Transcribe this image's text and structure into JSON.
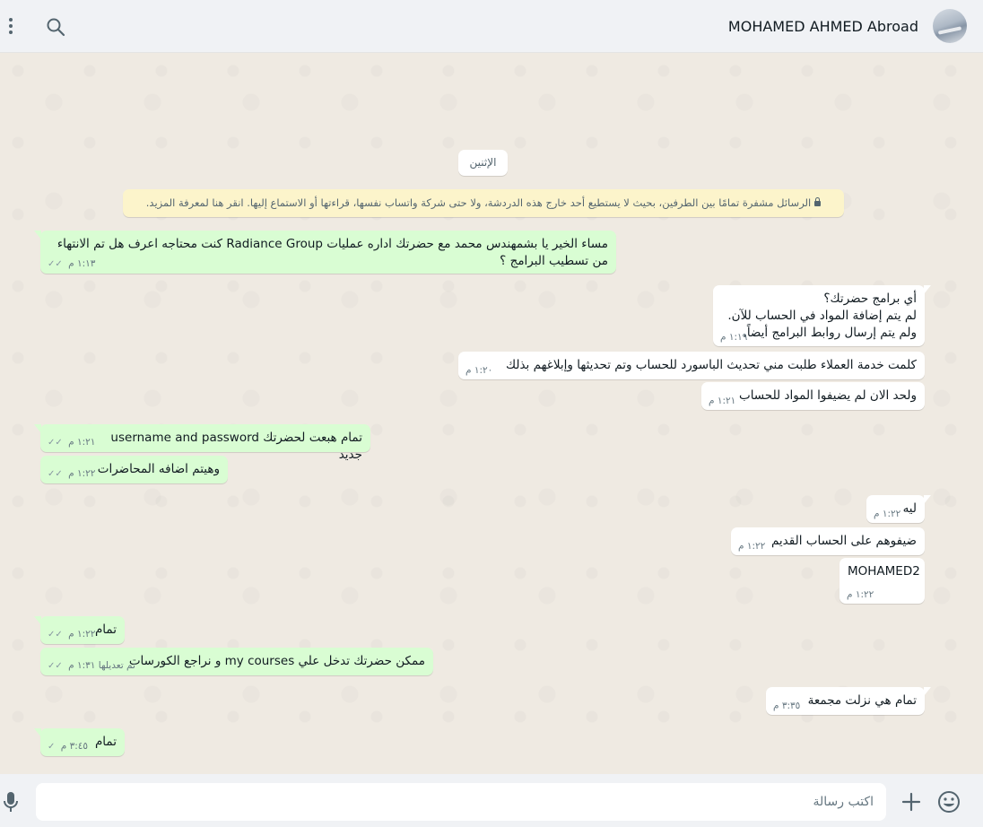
{
  "header": {
    "contact_name": "MOHAMED AHMED Abroad",
    "menu_icon": "more-vertical-icon",
    "search_icon": "search-icon"
  },
  "chat": {
    "date_chip": "الإثنين",
    "encryption_notice": "الرسائل مشفرة تمامًا بين الطرفين، بحيث لا يستطيع أحد خارج هذه الدردشة، ولا حتى شركة واتساب نفسها، قراءتها أو الاستماع إليها. انقر هنا لمعرفة المزيد.",
    "messages": [
      {
        "direction": "out",
        "text": "مساء الخير يا بشمهندس محمد مع حضرتك اداره عمليات Radiance Group كنت محتاجه اعرف هل تم الانتهاء من تسطيب البرامج ؟",
        "time": "١:١٣ م",
        "status": "read"
      },
      {
        "direction": "in",
        "text": "أي برامج حضرتك؟\nلم يتم إضافة المواد في الحساب للآن.\nولم يتم إرسال روابط البرامج أيضاً.",
        "time": "١:١٩ م"
      },
      {
        "direction": "in",
        "text": "كلمت خدمة العملاء طلبت مني تحديث الباسورد للحساب وتم تحديثها وإبلاغهم بذلك",
        "time": "١:٢٠ م"
      },
      {
        "direction": "in",
        "text": "ولحد الان لم يضيفوا المواد للحساب",
        "time": "١:٢١ م"
      },
      {
        "direction": "out",
        "text": "تمام هبعت لحضرتك username and password جديد",
        "time": "١:٢١ م",
        "status": "read"
      },
      {
        "direction": "out",
        "text": "وهيتم اضافه المحاضرات",
        "time": "١:٢٢ م",
        "status": "read"
      },
      {
        "direction": "in",
        "text": "ليه",
        "time": "١:٢٢ م"
      },
      {
        "direction": "in",
        "text": "ضيفوهم على الحساب القديم",
        "time": "١:٢٢ م"
      },
      {
        "direction": "in",
        "text": "MOHAMED2",
        "time": "١:٢٢ م"
      },
      {
        "direction": "out",
        "text": "تمام",
        "time": "١:٢٢ م",
        "status": "read"
      },
      {
        "direction": "out",
        "text": "ممكن حضرتك تدخل علي my courses و نراجع الكورسات",
        "time": "تم تعديلها ١:٣١ م",
        "status": "read"
      },
      {
        "direction": "in",
        "text": "تمام هي نزلت مجمعة",
        "time": "٣:٣٥ م"
      },
      {
        "direction": "out",
        "text": "تمام",
        "time": "٣:٤٥ م",
        "status": "sent"
      }
    ]
  },
  "composer": {
    "placeholder": "اكتب رسالة",
    "value": "",
    "mic_icon": "microphone-icon",
    "attach_icon": "plus-icon",
    "emoji_icon": "emoji-icon"
  },
  "colors": {
    "outgoing_bubble": "#d9fdd3",
    "incoming_bubble": "#ffffff",
    "chat_background": "#efeae2",
    "encryption_banner": "#fcf4cb"
  }
}
